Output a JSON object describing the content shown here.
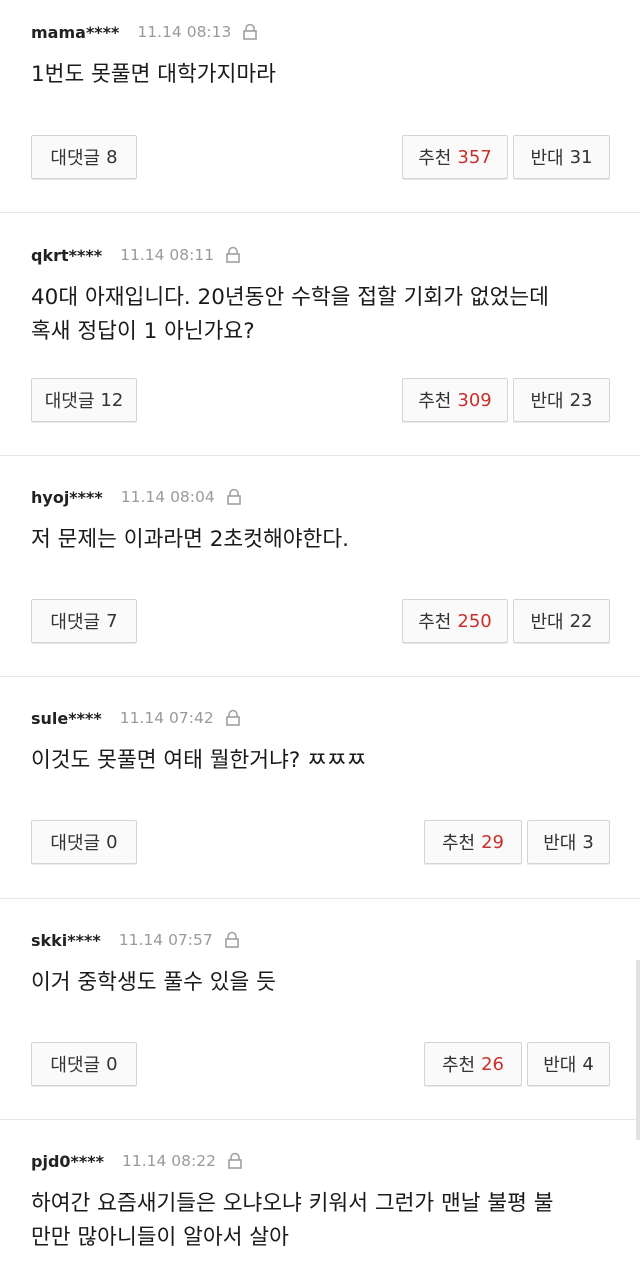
{
  "labels": {
    "reply": "대댓글",
    "like": "추천",
    "dislike": "반대"
  },
  "colors": {
    "like_count": "#c9302c",
    "timestamp": "#9a9a9a"
  },
  "comments": [
    {
      "user": "mama****",
      "time": "11.14 08:13",
      "lines": [
        "1번도 못풀면 대학가지마라"
      ],
      "replies": "8",
      "likes": "357",
      "dislikes": "31"
    },
    {
      "user": "qkrt****",
      "time": "11.14 08:11",
      "lines": [
        "40대 아재입니다. 20년동안 수학을 접할 기회가 없었는데",
        "혹새 정답이 1 아닌가요?"
      ],
      "replies": "12",
      "likes": "309",
      "dislikes": "23"
    },
    {
      "user": "hyoj****",
      "time": "11.14 08:04",
      "lines": [
        "저 문제는 이과라면 2초컷해야한다."
      ],
      "replies": "7",
      "likes": "250",
      "dislikes": "22"
    },
    {
      "user": "sule****",
      "time": "11.14 07:42",
      "lines": [
        "이것도 못풀면 여태 뭘한거냐? ㅉㅉㅉ"
      ],
      "replies": "0",
      "likes": "29",
      "dislikes": "3"
    },
    {
      "user": "skki****",
      "time": "11.14 07:57",
      "lines": [
        "이거 중학생도 풀수 있을 듯"
      ],
      "replies": "0",
      "likes": "26",
      "dislikes": "4"
    },
    {
      "user": "pjd0****",
      "time": "11.14 08:22",
      "lines": [
        "하여간 요즘새기들은 오냐오냐 키워서 그런가 맨날 불평 불",
        "만만 많아니들이 알아서 살아"
      ]
    }
  ]
}
